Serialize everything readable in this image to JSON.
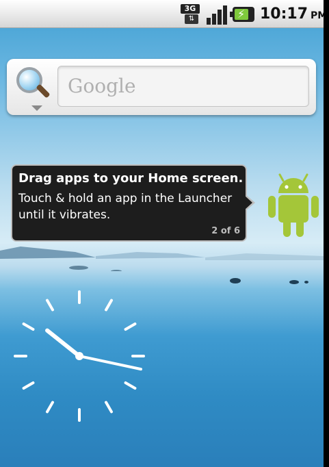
{
  "status_bar": {
    "network_type": "3G",
    "data_activity": "⇅",
    "time": "10:17",
    "ampm": "PM",
    "icons": [
      "3g-icon",
      "signal-strength-icon",
      "battery-charging-icon"
    ]
  },
  "search_widget": {
    "placeholder": "Google"
  },
  "tip": {
    "title": "Drag apps to your Home screen.",
    "body": "Touch & hold an app in the Launcher until it vibrates.",
    "counter": "2 of 6"
  },
  "clock": {
    "hour": 10,
    "minute": 17
  },
  "colors": {
    "android_green": "#a4c639",
    "sky": "#3f9fd3",
    "bubble": "#1d1d1d"
  }
}
